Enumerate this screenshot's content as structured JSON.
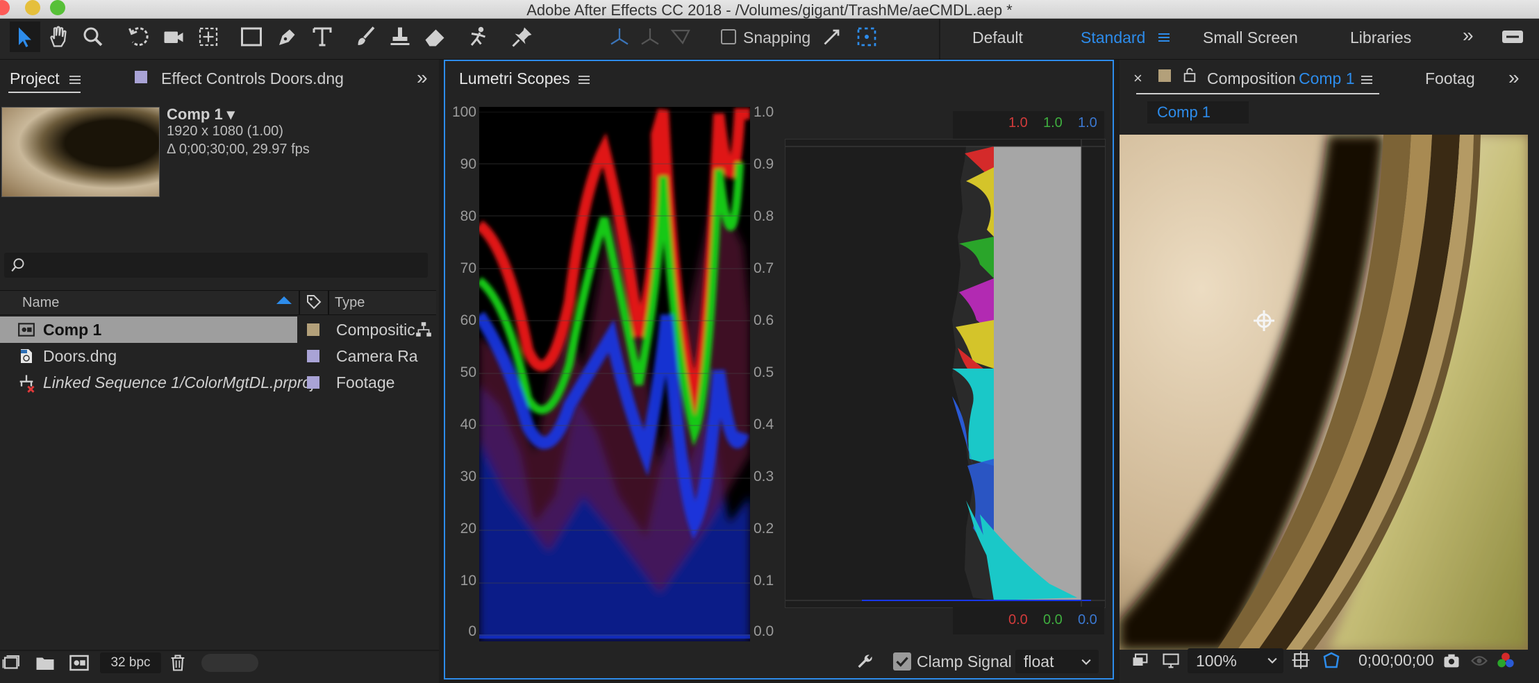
{
  "window": {
    "title": "Adobe After Effects CC 2018 - /Volumes/gigant/TrashMe/aeCMDL.aep *",
    "traffic_lights": [
      "#fc5b57",
      "#e5bf3c",
      "#57c038"
    ]
  },
  "toolbar": {
    "tools": [
      "selection-tool",
      "hand-tool",
      "zoom-tool",
      "rotate-tool",
      "camera-tool",
      "pan-behind-tool",
      "rectangle-tool",
      "pen-tool",
      "type-tool",
      "brush-tool",
      "clone-stamp-tool",
      "eraser-tool",
      "roto-brush-tool",
      "puppet-pin-tool"
    ],
    "snapping_label": "Snapping",
    "workspaces": [
      "Default",
      "Standard",
      "Small Screen",
      "Libraries"
    ],
    "active_workspace": "Standard",
    "accent": "#2d8ceb"
  },
  "project": {
    "tabs": [
      "Project",
      "Effect Controls Doors.dng"
    ],
    "comp_name": "Comp 1 ▾",
    "comp_res": "1920 x 1080 (1.00)",
    "comp_dur": "Δ 0;00;30;00, 29.97 fps",
    "columns": [
      "Name",
      "Type"
    ],
    "items": [
      {
        "name": "Comp 1",
        "type": "Compositic",
        "label_color": "#b3a07a",
        "selected": true
      },
      {
        "name": "Doors.dng",
        "type": "Camera Ra",
        "label_color": "#a9a3d6",
        "selected": false
      },
      {
        "name": "Linked Sequence 1/ColorMgtDL.prproj",
        "type": "Footage",
        "label_color": "#a9a3d6",
        "selected": false
      }
    ],
    "bpc": "32 bpc"
  },
  "lumetri": {
    "title": "Lumetri Scopes",
    "left_axis": [
      "100",
      "90",
      "80",
      "70",
      "60",
      "50",
      "40",
      "30",
      "20",
      "10",
      "0"
    ],
    "right_axis": [
      "1.0",
      "0.9",
      "0.8",
      "0.7",
      "0.6",
      "0.5",
      "0.4",
      "0.3",
      "0.2",
      "0.1",
      "0.0"
    ],
    "hist_top": {
      "r": "1.0",
      "g": "1.0",
      "b": "1.0"
    },
    "hist_bottom": {
      "r": "0.0",
      "g": "0.0",
      "b": "0.0"
    },
    "clamp_label": "Clamp Signal",
    "precision": "float"
  },
  "composition": {
    "tab_label": "Composition",
    "comp_tab": "Comp 1",
    "footage_tab": "Footag",
    "breadcrumb": "Comp 1",
    "zoom": "100%",
    "timecode": "0;00;00;00"
  }
}
